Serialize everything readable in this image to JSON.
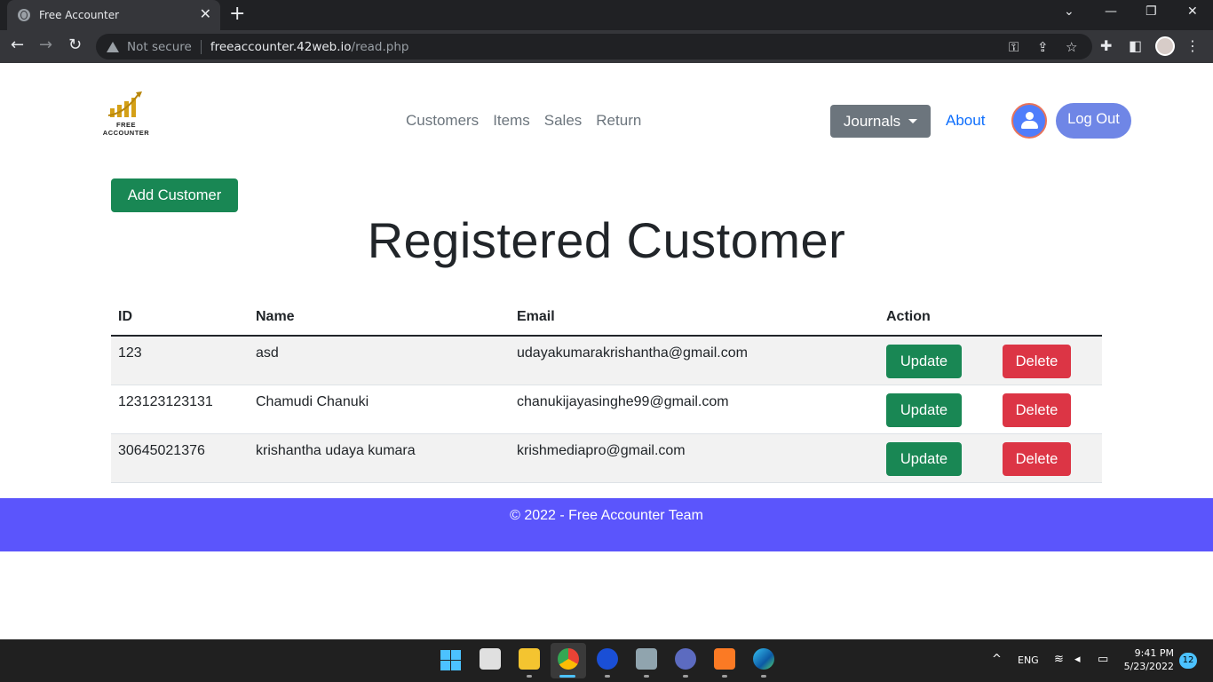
{
  "browser": {
    "tab_title": "Free Accounter",
    "tab_close": "✕",
    "new_tab": "+",
    "security_label": "Not secure",
    "url_host": "freeaccounter.42web.io",
    "url_path": "/read.php"
  },
  "site": {
    "logo_line1": "FREE",
    "logo_line2": "ACCOUNTER",
    "nav": [
      "Customers",
      "Items",
      "Sales",
      "Return"
    ],
    "journals_label": "Journals",
    "about_label": "About",
    "logout_label": "Log Out",
    "add_customer_label": "Add Customer",
    "heading": "Registered Customer"
  },
  "table": {
    "headers": [
      "ID",
      "Name",
      "Email",
      "Action"
    ],
    "update_label": "Update",
    "delete_label": "Delete",
    "rows": [
      {
        "id": "123",
        "name": "asd",
        "email": "udayakumarakrishantha@gmail.com"
      },
      {
        "id": "123123123131",
        "name": "Chamudi Chanuki",
        "email": "chanukijayasinghe99@gmail.com"
      },
      {
        "id": "30645021376",
        "name": "krishantha udaya kumara",
        "email": "krishmediapro@gmail.com"
      }
    ]
  },
  "footer": {
    "text": "© 2022 - Free Accounter Team"
  },
  "taskbar": {
    "language": "ENG",
    "time": "9:41 PM",
    "date": "5/23/2022",
    "notifications": "12"
  },
  "colors": {
    "success": "#198754",
    "danger": "#dc3545",
    "secondary": "#6c757d",
    "footer": "#5b55fc",
    "link": "#0d6efd"
  }
}
